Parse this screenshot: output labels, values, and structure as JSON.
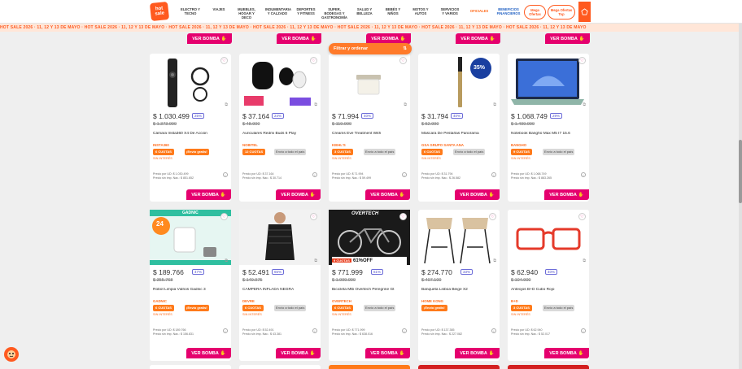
{
  "nav": {
    "logo_line1": "hot",
    "logo_line2": "sale",
    "items": [
      {
        "label": "ELECTRO Y TECNO",
        "style": ""
      },
      {
        "label": "VIAJES",
        "style": ""
      },
      {
        "label": "MUEBLES, HOGAR Y DECO",
        "style": ""
      },
      {
        "label": "INDUMENTARIA Y CALZADO",
        "style": ""
      },
      {
        "label": "DEPORTES Y FITNESS",
        "style": ""
      },
      {
        "label": "SUPER, BODEGAS Y GASTRONOMÍA",
        "style": ""
      },
      {
        "label": "SALUD Y BELLEZA",
        "style": ""
      },
      {
        "label": "BEBÉS Y NIÑOS",
        "style": ""
      },
      {
        "label": "MOTOS Y AUTOS",
        "style": ""
      },
      {
        "label": "SERVICIOS Y VARIOS",
        "style": ""
      },
      {
        "label": "OFICIALES",
        "style": "orange"
      },
      {
        "label": "BENEFICIOS FINANCIEROS",
        "style": "blue"
      }
    ],
    "btn_mega_ofertas": "Mega Ofertas",
    "btn_mega_ofertas_top": "Mega Ofertas Top"
  },
  "ticker": "HOT SALE 2026 · 11, 12 Y 13 DE MAYO · HOT SALE 2026 · 11, 12 Y 13 DE MAYO · HOT SALE 2026 · 11, 12 Y 13 DE MAYO · HOT SALE 2026 · 11, 12 Y 13 DE MAYO · HOT SALE 2026 · 11, 12 Y 13 DE MAYO · HOT SALE 2026 · 11, 12 Y 13 DE MAYO · HOT SALE 2026 · 11, 12 Y 13 DE MAYO",
  "filter_label": "Filtrar y ordenar",
  "bomba_label": "VER BOMBA",
  "row1": [
    {
      "name": "Cámara Insta360 X4 De Acción",
      "price": "$ 1.030.499",
      "discount": "25%",
      "old_price": "$ 1.373.999",
      "seller": "INSTA360",
      "tag1": "6 CUOTAS",
      "tag2": "¡Envío gratis!",
      "tag2_orange": true,
      "installments": "SIN INTERÉS",
      "fine1": "Precio por UD: $ 1.030.499",
      "fine2": "Precio sin imp. Nac.: $ 851.652"
    },
    {
      "name": "Auriculares Redmi Buds 6 Play",
      "price": "$ 37.164",
      "discount": "24%",
      "old_price": "$ 48.900",
      "seller": "NOBITEL",
      "tag1": "12 CUOTAS",
      "tag2": "Envío a todo el país",
      "tag2_orange": false,
      "installments": "",
      "fine1": "Precio por UD: $ 37.164",
      "fine2": "Precio sin imp. Nac.: $ 30.714"
    },
    {
      "name": "Creams Eve Treatment With",
      "price": "$ 71.994",
      "discount": "40%",
      "old_price": "$ 119.990",
      "seller": "KIEHL'S",
      "tag1": "3 CUOTAS",
      "tag2": "Envío a todo el país",
      "tag2_orange": false,
      "installments": "SIN INTERÉS",
      "fine1": "Precio por UD: $ 71.994",
      "fine2": "Precio sin imp. Nac.: $ 59.499"
    },
    {
      "name": "Máscara De Pestañas Panorama",
      "price": "$ 31.794",
      "discount": "40%",
      "old_price": "$ 52.990",
      "seller": "GSA GRUPO SANTA ANA",
      "tag1": "6 CUOTAS",
      "tag2": "Envío a todo el país",
      "tag2_orange": false,
      "installments": "SIN INTERÉS",
      "fine1": "Precio por UD: $ 31.794",
      "fine2": "Precio sin imp. Nac.: $ 26.582"
    },
    {
      "name": "Notebook Banghó Max M5 I7 15.6",
      "price": "$ 1.068.749",
      "discount": "29%",
      "old_price": "$ 1.499.999",
      "seller": "BANGHO",
      "tag1": "9 CUOTAS",
      "tag2": "Envío a todo el país",
      "tag2_orange": false,
      "installments": "SIN INTERÉS",
      "fine1": "Precio por UD: $ 1.068.749",
      "fine2": "Precio sin imp. Nac.: $ 883.265"
    }
  ],
  "row2": [
    {
      "name": "Robot Limpia Vidrios Gadnic 3",
      "price": "$ 189.766",
      "discount": "47%",
      "old_price": "$ 355.768",
      "seller": "GADNIC",
      "tag1": "6 CUOTAS",
      "tag2": "¡Envío gratis!",
      "tag2_orange": true,
      "installments": "SIN INTERÉS",
      "fine1": "Precio por UD: $ 189.766",
      "fine2": "Precio sin imp. Nac.: $ 156.831"
    },
    {
      "name": "CAMPERA INFLADA NEGRA",
      "price": "$ 52.491",
      "discount": "65%",
      "old_price": "$ 149.975",
      "seller": "DEVRE",
      "tag1": "6 CUOTAS",
      "tag2": "Envío a todo el país",
      "tag2_orange": false,
      "installments": "SIN INTERÉS",
      "fine1": "Precio por UD: $ 52.491",
      "fine2": "Precio sin imp. Nac.: $ 43.381"
    },
    {
      "name": "Bicicleta Mtb Overtech Peregrine Gt",
      "price": "$ 771.999",
      "discount": "61%",
      "old_price": "$ 1.999.999",
      "seller": "OVERTECH",
      "tag1": "6 CUOTAS",
      "tag2": "Envío a todo el país",
      "tag2_orange": false,
      "installments": "SIN INTERÉS",
      "fine1": "Precio por UD: $ 771.999",
      "fine2": "Precio sin imp. Nac.: $ 638.016"
    },
    {
      "name": "Banqueta Lisboa Beige X2",
      "price": "$ 274.770",
      "discount": "33%",
      "old_price": "$ 407.100",
      "seller": "HOME KONG",
      "tag1": "¡Envío gratis!",
      "tag2": "",
      "tag2_orange": false,
      "installments": "",
      "fine1": "Precio por UD: $ 137.385",
      "fine2": "Precio sin imp. Nac.: $ 227.082"
    },
    {
      "name": "Anteojos B+D Cubo Rojo",
      "price": "$ 62.940",
      "discount": "40%",
      "old_price": "$ 104.900",
      "seller": "B+D",
      "tag1": "3 CUOTAS",
      "tag2": "Envío a todo el país",
      "tag2_orange": false,
      "installments": "SIN INTERÉS",
      "fine1": "Precio por UD: $ 62.940",
      "fine2": "Precio sin imp. Nac.: $ 52.017"
    }
  ],
  "row2_badges": {
    "gadnic_brand": "GADNIC",
    "gadnic_24": "24",
    "overtech_brand": "OVERTECH",
    "overtech_9": "9 CUOTAS",
    "overtech_pct": "61%OFF",
    "mascara_pct": "35%"
  }
}
